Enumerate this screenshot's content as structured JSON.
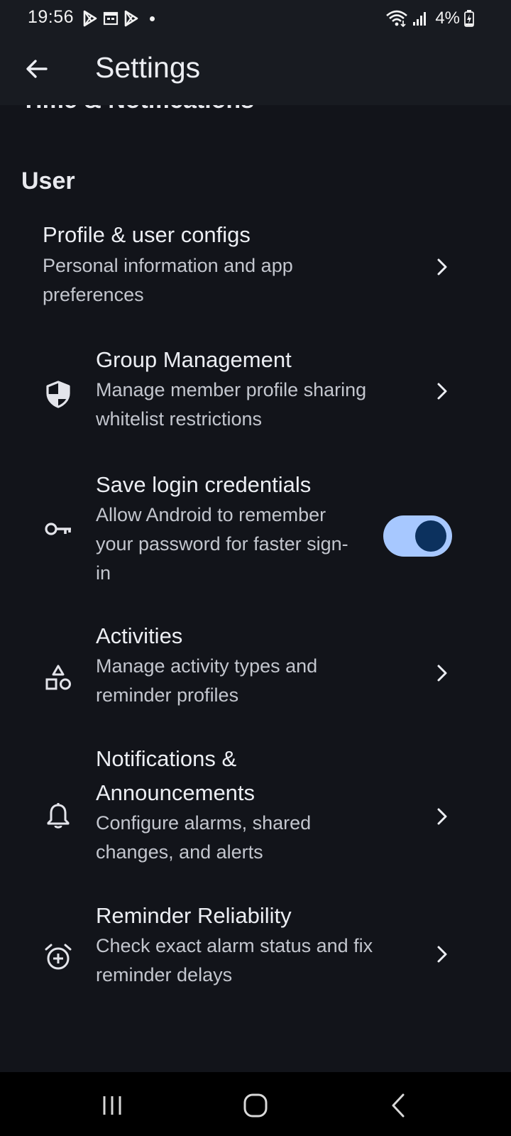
{
  "status_bar": {
    "time": "19:56",
    "battery": "4%"
  },
  "app_bar": {
    "title": "Settings"
  },
  "previous_section_title": "Time & Notifications",
  "section": {
    "header": "User"
  },
  "items": [
    {
      "title": "Profile & user configs",
      "subtitle": "Personal information and app preferences",
      "icon": "none",
      "trailing": "chevron-right"
    },
    {
      "title": "Group Management",
      "subtitle": "Manage member profile sharing whitelist restrictions",
      "icon": "shield-icon",
      "trailing": "chevron-right"
    },
    {
      "title": "Save login credentials",
      "subtitle": "Allow Android to remember your password for faster sign-in",
      "icon": "key-icon",
      "trailing": "toggle",
      "toggle_on": true
    },
    {
      "title": "Activities",
      "subtitle": "Manage activity types and reminder profiles",
      "icon": "shapes-icon",
      "trailing": "chevron-right"
    },
    {
      "title": "Notifications & Announcements",
      "subtitle": "Configure alarms, shared changes, and alerts",
      "icon": "bell-icon",
      "trailing": "chevron-right"
    },
    {
      "title": "Reminder Reliability",
      "subtitle": "Check exact alarm status and fix reminder delays",
      "icon": "alarm-add-icon",
      "trailing": "chevron-right"
    }
  ],
  "colors": {
    "background": "#12141a",
    "app_bar": "#181b21",
    "toggle_track": "#a7c8ff",
    "toggle_knob": "#0c315e",
    "text_primary": "#eceef3",
    "text_secondary": "#c3c6ce"
  },
  "nav_bar": {
    "buttons": [
      "recents-icon",
      "home-icon",
      "back-icon"
    ]
  }
}
